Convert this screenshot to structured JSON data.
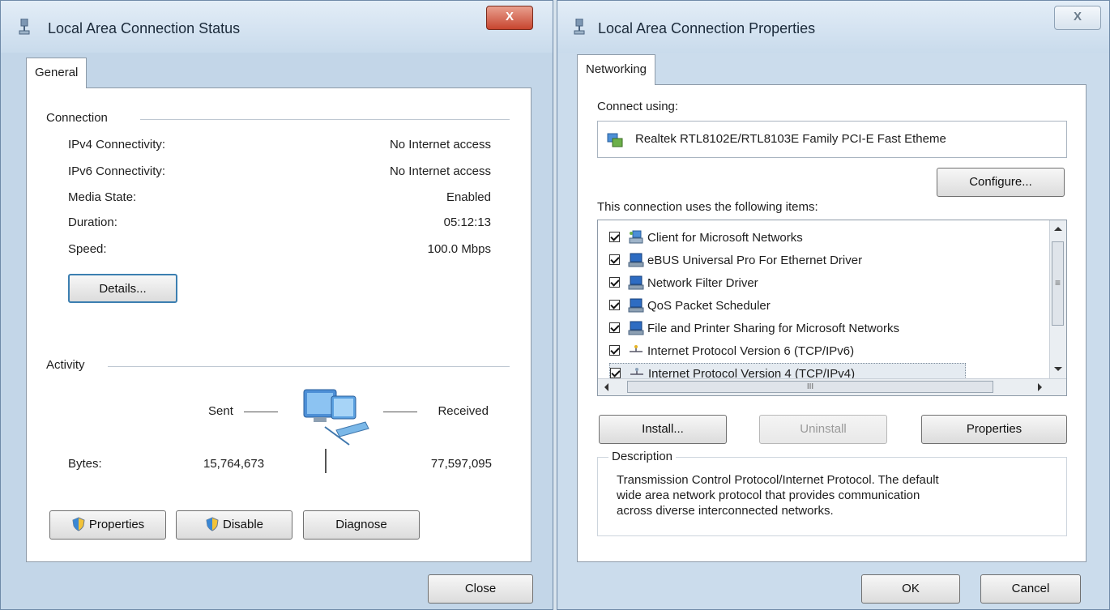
{
  "status_window": {
    "title": "Local Area Connection Status",
    "close_glyph": "X",
    "tab": "General",
    "connection": {
      "label": "Connection",
      "rows": [
        {
          "label": "IPv4 Connectivity:",
          "value": "No Internet access"
        },
        {
          "label": "IPv6 Connectivity:",
          "value": "No Internet access"
        },
        {
          "label": "Media State:",
          "value": "Enabled"
        },
        {
          "label": "Duration:",
          "value": "05:12:13"
        },
        {
          "label": "Speed:",
          "value": "100.0 Mbps"
        }
      ],
      "details_button": "Details..."
    },
    "activity": {
      "label": "Activity",
      "sent_label": "Sent",
      "received_label": "Received",
      "bytes_label": "Bytes:",
      "bytes_sent": "15,764,673",
      "bytes_received": "77,597,095"
    },
    "buttons": {
      "properties": "Properties",
      "disable": "Disable",
      "diagnose": "Diagnose",
      "close": "Close"
    }
  },
  "properties_window": {
    "title": "Local Area Connection Properties",
    "close_glyph": "X",
    "tab": "Networking",
    "connect_using_label": "Connect using:",
    "adapter_name": "Realtek RTL8102E/RTL8103E Family PCI-E Fast Etheme",
    "configure_button": "Configure...",
    "items_label": "This connection uses the following items:",
    "items": [
      {
        "label": "Client for Microsoft Networks",
        "checked": true,
        "icon": "client-network-icon"
      },
      {
        "label": "eBUS Universal Pro For Ethernet Driver",
        "checked": true,
        "icon": "network-service-icon"
      },
      {
        "label": "Network Filter Driver",
        "checked": true,
        "icon": "network-service-icon"
      },
      {
        "label": "QoS Packet Scheduler",
        "checked": true,
        "icon": "network-service-icon"
      },
      {
        "label": "File and Printer Sharing for Microsoft Networks",
        "checked": true,
        "icon": "network-service-icon"
      },
      {
        "label": "Internet Protocol Version 6 (TCP/IPv6)",
        "checked": true,
        "icon": "protocol-icon"
      },
      {
        "label": "Internet Protocol Version 4 (TCP/IPv4)",
        "checked": true,
        "icon": "protocol-icon",
        "selected": true
      }
    ],
    "hscroll_thumb_glyph": "III",
    "vscroll_thumb_glyph": "≡",
    "install_button": "Install...",
    "uninstall_button": "Uninstall",
    "properties_button": "Properties",
    "description_label": "Description",
    "description_lines": [
      "Transmission Control Protocol/Internet Protocol. The default",
      "wide area network protocol that provides communication",
      "across diverse interconnected networks."
    ],
    "ok_button": "OK",
    "cancel_button": "Cancel"
  },
  "colors": {
    "titlebar": "#c9dbec",
    "close_red": "#c7452f",
    "selection": "#e5ebf1"
  }
}
